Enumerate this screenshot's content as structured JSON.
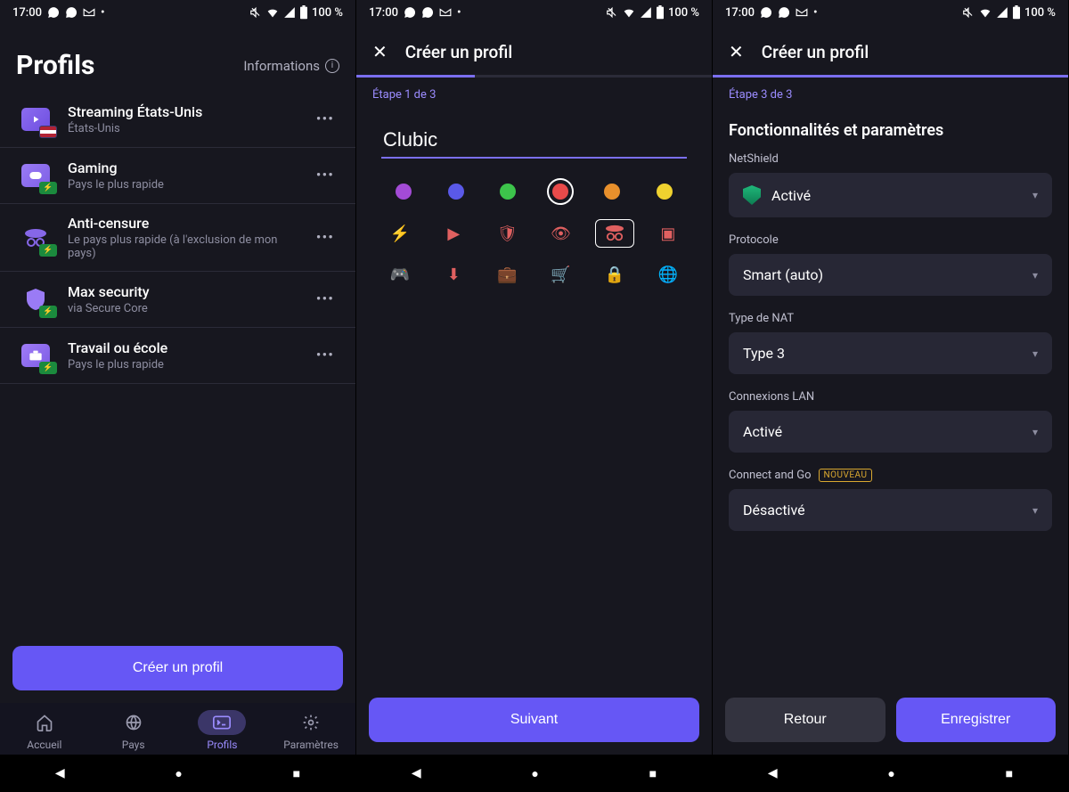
{
  "status": {
    "time": "17:00",
    "battery": "100 %"
  },
  "screen1": {
    "title": "Profils",
    "info": "Informations",
    "profiles": [
      {
        "name": "Streaming États-Unis",
        "sub": "États-Unis"
      },
      {
        "name": "Gaming",
        "sub": "Pays le plus rapide"
      },
      {
        "name": "Anti-censure",
        "sub": "Le pays plus rapide (à l'exclusion de mon pays)"
      },
      {
        "name": "Max security",
        "sub": "via Secure Core"
      },
      {
        "name": "Travail ou école",
        "sub": "Pays le plus rapide"
      }
    ],
    "create": "Créer un profil",
    "nav": {
      "home": "Accueil",
      "countries": "Pays",
      "profiles": "Profils",
      "settings": "Paramètres"
    }
  },
  "screen2": {
    "title": "Créer un profil",
    "step": "Étape 1 de 3",
    "name_value": "Clubic",
    "colors": [
      "#a34bd6",
      "#5a59e8",
      "#3dc44b",
      "#e84a4a",
      "#e8902c",
      "#efd22f"
    ],
    "selected_color": 3,
    "next": "Suivant"
  },
  "screen3": {
    "title": "Créer un profil",
    "step": "Étape 3 de 3",
    "section": "Fonctionnalités et paramètres",
    "fields": {
      "netshield_label": "NetShield",
      "netshield_value": "Activé",
      "protocol_label": "Protocole",
      "protocol_value": "Smart (auto)",
      "nat_label": "Type de NAT",
      "nat_value": "Type 3",
      "lan_label": "Connexions LAN",
      "lan_value": "Activé",
      "cng_label": "Connect and Go",
      "cng_badge": "NOUVEAU",
      "cng_value": "Désactivé"
    },
    "back": "Retour",
    "save": "Enregistrer"
  }
}
